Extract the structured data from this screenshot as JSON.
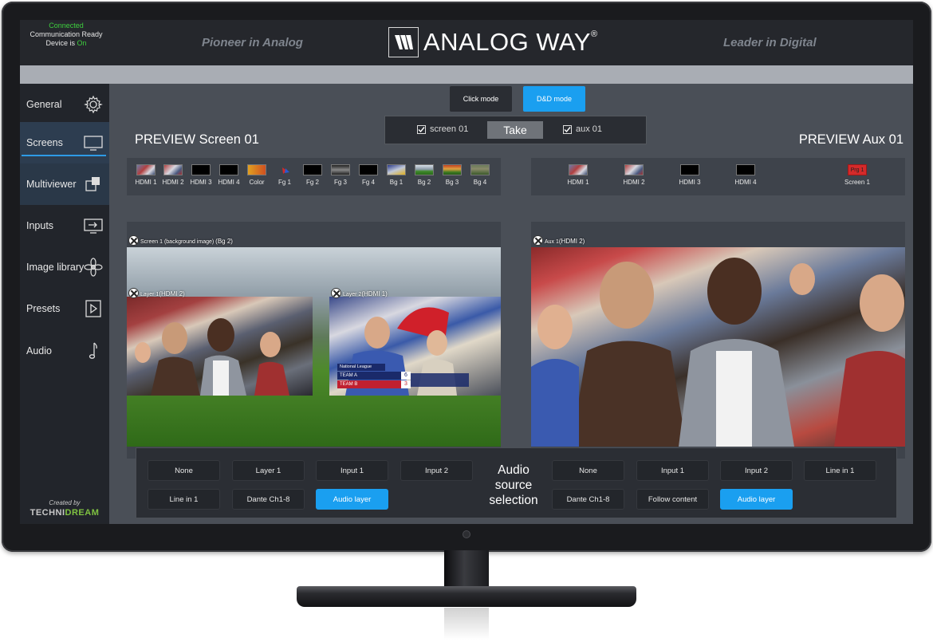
{
  "header": {
    "status_connected": "Connected",
    "status_comm": "Communication Ready",
    "status_device_prefix": "Device is",
    "status_device_state": "On",
    "tagline_left": "Pioneer in Analog",
    "tagline_right": "Leader in Digital",
    "brand": "ANALOG WAY",
    "brand_mark": "®"
  },
  "sidebar": {
    "items": [
      {
        "label": "General",
        "icon": "gear-icon"
      },
      {
        "label": "Screens",
        "icon": "monitor-icon",
        "active": true
      },
      {
        "label": "Multiviewer",
        "icon": "multiviewer-icon"
      },
      {
        "label": "Inputs",
        "icon": "input-icon"
      },
      {
        "label": "Image library",
        "icon": "flower-icon"
      },
      {
        "label": "Presets",
        "icon": "play-icon"
      },
      {
        "label": "Audio",
        "icon": "music-note-icon"
      }
    ],
    "credit_label": "Created by",
    "credit_brand_1": "TECHNI",
    "credit_brand_2": "DREAM"
  },
  "modes": {
    "click": "Click mode",
    "dnd": "D&D mode",
    "active": "dnd"
  },
  "take_bar": {
    "screen_label": "screen 01",
    "take_label": "Take",
    "aux_label": "aux 01"
  },
  "preview": {
    "screen_title": "PREVIEW Screen 01",
    "aux_title": "PREVIEW Aux 01"
  },
  "screen_sources": [
    {
      "label": "HDMI 1"
    },
    {
      "label": "HDMI 2"
    },
    {
      "label": "HDMI 3"
    },
    {
      "label": "HDMI 4"
    },
    {
      "label": "Color"
    },
    {
      "label": "Fg 1"
    },
    {
      "label": "Fg 2"
    },
    {
      "label": "Fg 3"
    },
    {
      "label": "Fg 4"
    },
    {
      "label": "Bg 1"
    },
    {
      "label": "Bg 2"
    },
    {
      "label": "Bg 3"
    },
    {
      "label": "Bg 4"
    }
  ],
  "aux_sources": [
    {
      "label": "HDMI 1"
    },
    {
      "label": "HDMI 2"
    },
    {
      "label": "HDMI 3"
    },
    {
      "label": "HDMI 4"
    },
    {
      "label": "Screen 1",
      "badge": "Prg 1"
    }
  ],
  "screen_canvas": {
    "background_caption": "Screen 1 (background image)",
    "background_source": "(Bg 2)",
    "layer1_caption": "Layer 1",
    "layer1_source": "(HDMI 2)",
    "layer2_caption": "Layer 2",
    "layer2_source": "(HDMI 1)",
    "score_league": "National League",
    "score_team_a": "TEAM A",
    "score_team_b": "TEAM B",
    "score_a": "6",
    "score_b": "3"
  },
  "aux_canvas": {
    "caption": "Aux 1",
    "source": "(HDMI 2)"
  },
  "audio": {
    "title_line1": "Audio",
    "title_line2": "source",
    "title_line3": "selection",
    "left_row1": [
      "None",
      "Layer 1",
      "Input 1",
      "Input 2"
    ],
    "left_row2": [
      "Line in 1",
      "Dante Ch1-8",
      "Audio layer"
    ],
    "left_selected": "Audio layer",
    "right_row1": [
      "None",
      "Input 1",
      "Input 2",
      "Line in 1"
    ],
    "right_row2": [
      "Dante Ch1-8",
      "Follow content",
      "Audio layer"
    ],
    "right_selected": "Audio layer"
  },
  "colors": {
    "accent": "#1a9ff0",
    "status_green": "#3ecf3e",
    "sidebar_active": "#2d3d50",
    "prg_badge": "#d42a2a"
  }
}
